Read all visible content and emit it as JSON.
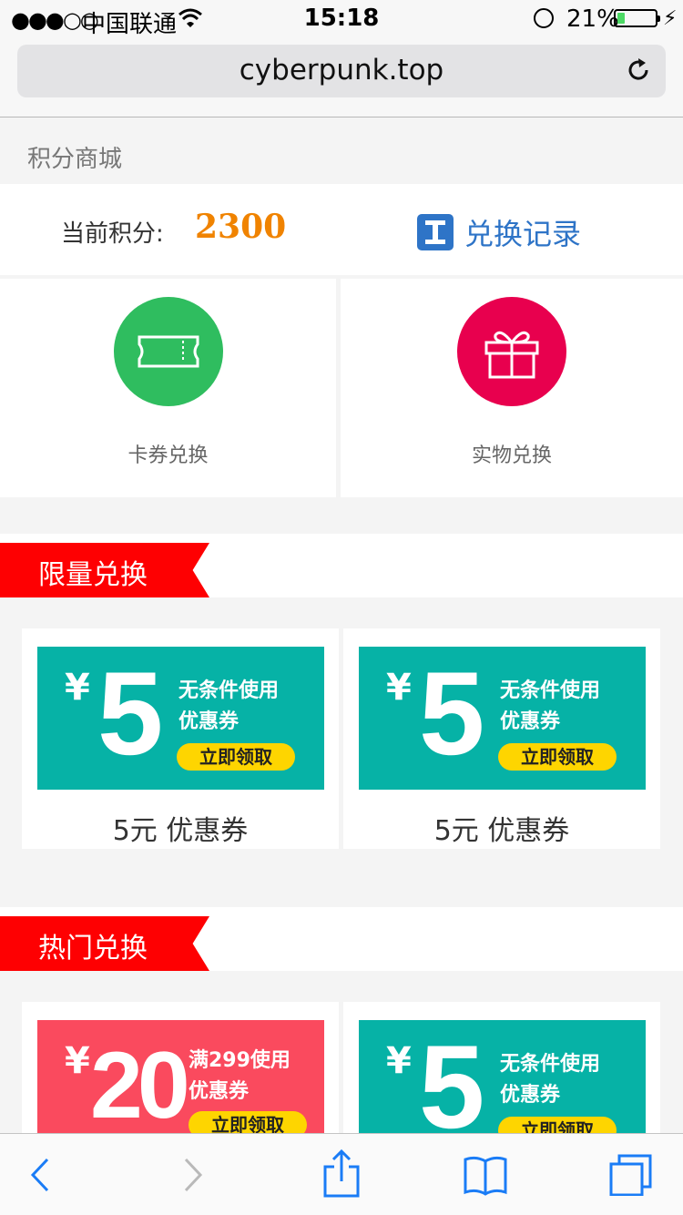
{
  "status_bar": {
    "signal": "●●●○○",
    "carrier": "中国联通",
    "time": "15:18",
    "battery_pct": "21%",
    "battery_level": 0.21,
    "bolt": "⚡"
  },
  "browser": {
    "url": "cyberpunk.top",
    "reload_icon": "reload-icon"
  },
  "page": {
    "title": "积分商城",
    "points_label": "当前积分:",
    "points_value": "2300",
    "history_label": "兑换记录",
    "accent_color": "#f08300",
    "link_color": "#2e74c7"
  },
  "categories": [
    {
      "label": "卡券兑换",
      "icon": "ticket-icon",
      "color": "#2fbd5f"
    },
    {
      "label": "实物兑换",
      "icon": "gift-icon",
      "color": "#e8004e"
    }
  ],
  "sections": [
    {
      "title": "限量兑换",
      "items": [
        {
          "yen": "¥",
          "amount": "5",
          "line1": "无条件使用",
          "line2": "优惠券",
          "cta": "立即领取",
          "name": "5元 优惠券",
          "theme": "teal"
        },
        {
          "yen": "¥",
          "amount": "5",
          "line1": "无条件使用",
          "line2": "优惠券",
          "cta": "立即领取",
          "name": "5元 优惠券",
          "theme": "teal"
        }
      ]
    },
    {
      "title": "热门兑换",
      "items": [
        {
          "yen": "¥",
          "amount": "20",
          "line1": "满299使用",
          "line2": "优惠券",
          "cta": "立即领取",
          "name": "",
          "theme": "red"
        },
        {
          "yen": "¥",
          "amount": "5",
          "line1": "无条件使用",
          "line2": "优惠券",
          "cta": "立即领取",
          "name": "",
          "theme": "teal"
        }
      ]
    }
  ],
  "toolbar": {
    "icons": [
      "back-icon",
      "forward-icon",
      "share-icon",
      "bookmarks-icon",
      "tabs-icon"
    ]
  }
}
